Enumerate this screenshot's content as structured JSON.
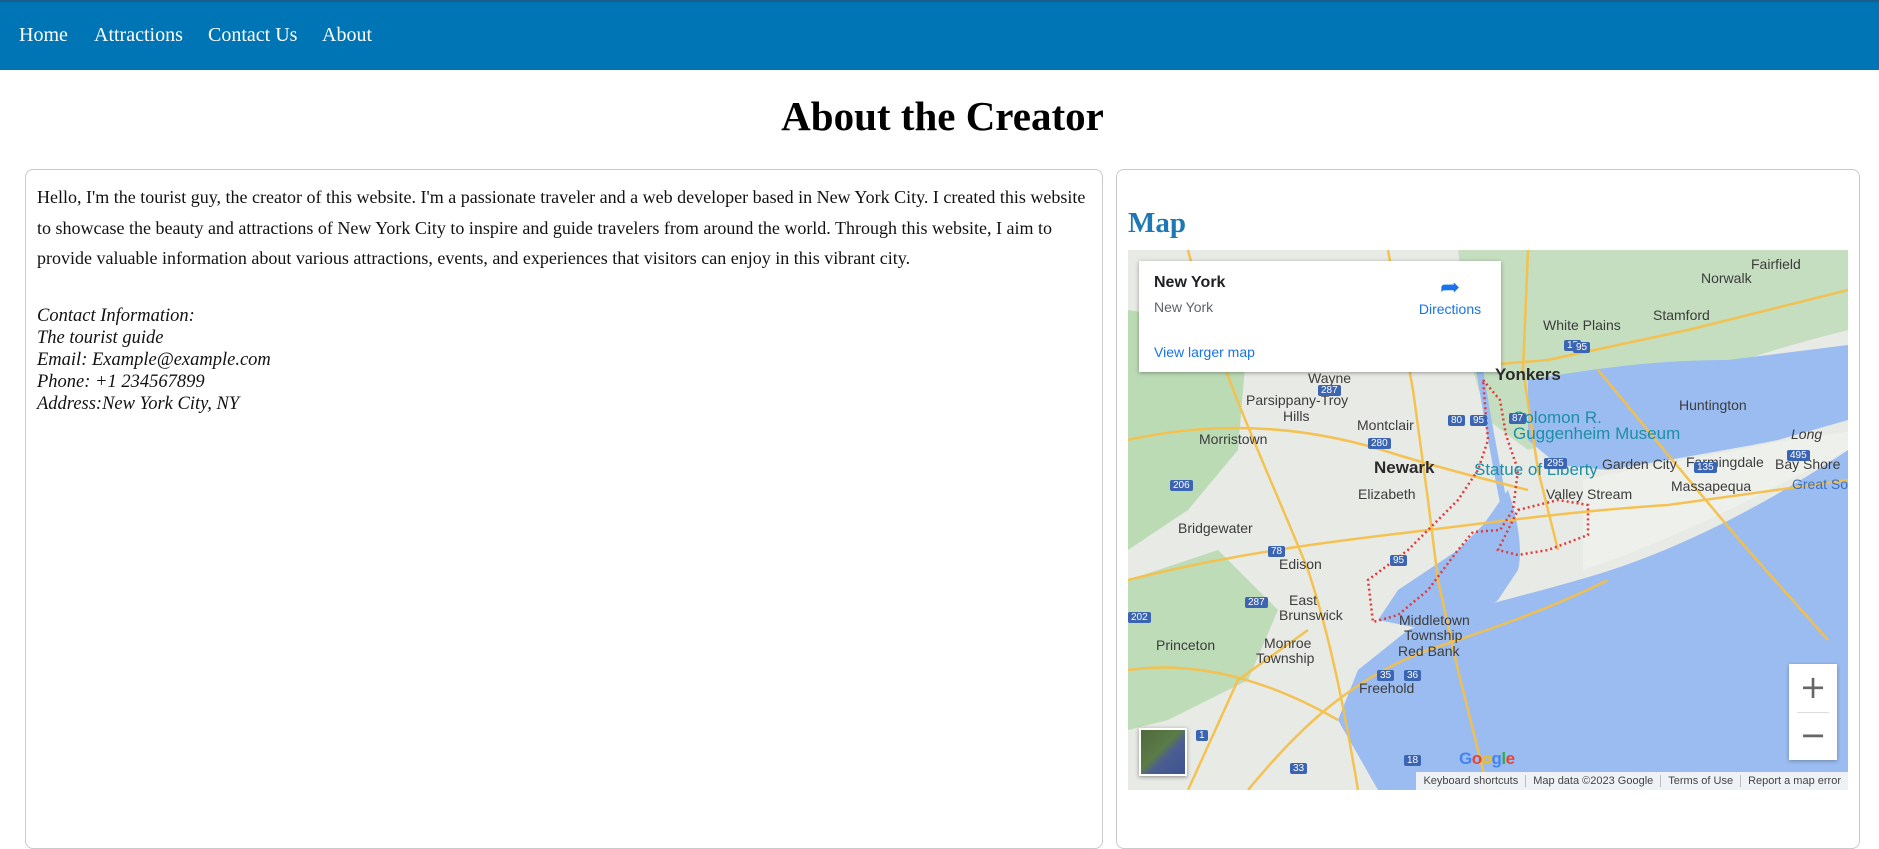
{
  "nav": {
    "home": "Home",
    "attractions": "Attractions",
    "contact": "Contact Us",
    "about": "About"
  },
  "page": {
    "title": "About the Creator"
  },
  "about": {
    "bio": "Hello, I'm the tourist guy, the creator of this website. I'm a passionate traveler and a web developer based in New York City. I created this website to showcase the beauty and attractions of New York City to inspire and guide travelers from around the world. Through this website, I aim to provide valuable information about various attractions, events, and experiences that visitors can enjoy in this vibrant city.",
    "contact_heading": "Contact Information:",
    "contact_name": "The tourist guide",
    "contact_email": "Email: Example@example.com",
    "contact_phone": "Phone: +1 234567899",
    "contact_address": "Address:New York City, NY"
  },
  "map": {
    "title": "Map",
    "card": {
      "name": "New York",
      "subtitle": "New York",
      "directions": "Directions",
      "larger_map": "View larger map"
    },
    "labels": {
      "fairfield": "Fairfield",
      "norwalk": "Norwalk",
      "white_plains": "White Plains",
      "stamford": "Stamford",
      "wayne": "Wayne",
      "yonkers": "Yonkers",
      "parsippany": "Parsippany-Troy",
      "parsippany2": "Hills",
      "huntington": "Huntington",
      "montclair": "Montclair",
      "guggenheim1": "Solomon R.",
      "guggenheim2": "Guggenheim Museum",
      "morristown": "Morristown",
      "newark": "Newark",
      "statue": "Statue of Liberty",
      "garden_city": "Garden City",
      "farmingdale": "Farmingdale",
      "bay_shore": "Bay Shore",
      "elizabeth": "Elizabeth",
      "valley_stream": "Valley Stream",
      "massapequa": "Massapequa",
      "great_south": "Great Sout",
      "bridgewater": "Bridgewater",
      "edison": "Edison",
      "east_brunswick1": "East",
      "east_brunswick2": "Brunswick",
      "middletown1": "Middletown",
      "middletown2": "Township",
      "princeton": "Princeton",
      "monroe1": "Monroe",
      "monroe2": "Township",
      "red_bank": "Red Bank",
      "freehold": "Freehold",
      "long": "Long"
    },
    "shields": {
      "s287a": "287",
      "s80": "80",
      "s95a": "95",
      "s87": "87",
      "s280": "280",
      "s495": "495",
      "s206": "206",
      "s295": "295",
      "s135": "135",
      "s78": "78",
      "s95b": "95",
      "s287b": "287",
      "s35": "35",
      "s36": "36",
      "s33": "33",
      "s18": "18",
      "s202": "202",
      "s1": "1",
      "s95c": "95",
      "s15": "15"
    },
    "zoom_in": "+",
    "zoom_out": "−",
    "logo": "Google",
    "attribution": {
      "shortcuts": "Keyboard shortcuts",
      "data": "Map data ©2023 Google",
      "terms": "Terms of Use",
      "report": "Report a map error"
    },
    "colors": {
      "land": "#e8eae6",
      "water": "#9bbcf0",
      "park": "#a8d4a0",
      "highway": "#f5c04a",
      "boundary": "#e03a3a"
    }
  }
}
